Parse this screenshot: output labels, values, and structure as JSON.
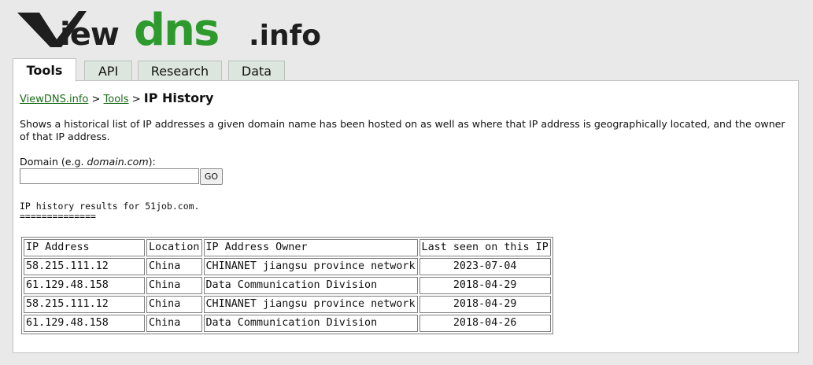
{
  "logo": {
    "part1": "View",
    "part2": "dns",
    "part3": ".info",
    "colors": {
      "dark": "#1e1e1e",
      "green": "#2e9a2e"
    }
  },
  "tabs": [
    {
      "label": "Tools",
      "active": true
    },
    {
      "label": "API",
      "active": false
    },
    {
      "label": "Research",
      "active": false
    },
    {
      "label": "Data",
      "active": false
    }
  ],
  "breadcrumb": {
    "home": "ViewDNS.info",
    "sep1": ">",
    "tools": "Tools",
    "sep2": ">",
    "current": "IP History"
  },
  "description": "Shows a historical list of IP addresses a given domain name has been hosted on as well as where that IP address is geographically located, and the owner of that IP address.",
  "form": {
    "label_prefix": "Domain (e.g. ",
    "label_example": "domain.com",
    "label_suffix": "):",
    "input_value": "",
    "go_label": "GO"
  },
  "results": {
    "heading": "IP history results for 51job.com.",
    "underline": "==============",
    "columns": [
      "IP Address",
      "Location",
      "IP Address Owner",
      "Last seen on this IP"
    ],
    "rows": [
      [
        "58.215.111.12",
        "China",
        "CHINANET jiangsu province network",
        "2023-07-04"
      ],
      [
        "61.129.48.158",
        "China",
        "Data Communication Division",
        "2018-04-29"
      ],
      [
        "58.215.111.12",
        "China",
        "CHINANET jiangsu province network",
        "2018-04-29"
      ],
      [
        "61.129.48.158",
        "China",
        "Data Communication Division",
        "2018-04-26"
      ]
    ]
  }
}
